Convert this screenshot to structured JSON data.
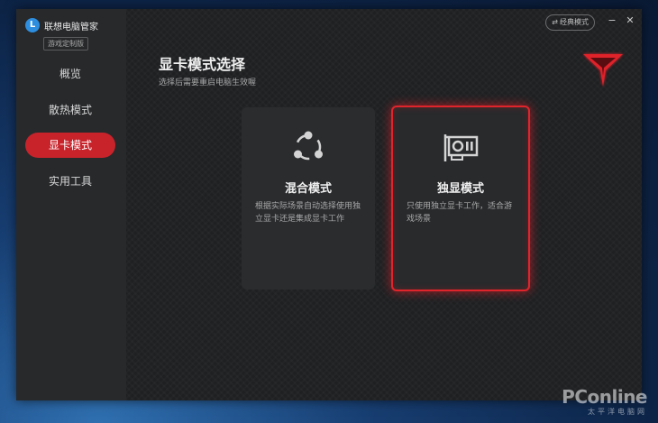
{
  "app": {
    "name": "联想电脑管家",
    "badge": "游戏定制版"
  },
  "sidebar": {
    "items": [
      {
        "label": "概览"
      },
      {
        "label": "散热模式"
      },
      {
        "label": "显卡模式"
      },
      {
        "label": "实用工具"
      }
    ],
    "active_index": 2
  },
  "titlebar": {
    "classic_mode_label": "经典模式",
    "classic_mode_icon": "swap-arrows-icon",
    "minimize_glyph": "−",
    "close_glyph": "✕"
  },
  "main": {
    "title": "显卡模式选择",
    "subtitle": "选择后需要重启电脑生效喔",
    "cards": [
      {
        "title": "混合模式",
        "description": "根据实际场景自动选择使用独立显卡还是集成显卡工作",
        "icon": "hybrid-share-icon",
        "selected": false
      },
      {
        "title": "独显模式",
        "description": "只使用独立显卡工作，适合游戏场景",
        "icon": "graphics-card-icon",
        "selected": true
      }
    ]
  },
  "colors": {
    "accent": "#c8232b",
    "selected_border": "#e0242c",
    "logo_red": "#e0242c"
  },
  "watermark": {
    "main": "PConline",
    "sub": "太平洋电脑网"
  }
}
